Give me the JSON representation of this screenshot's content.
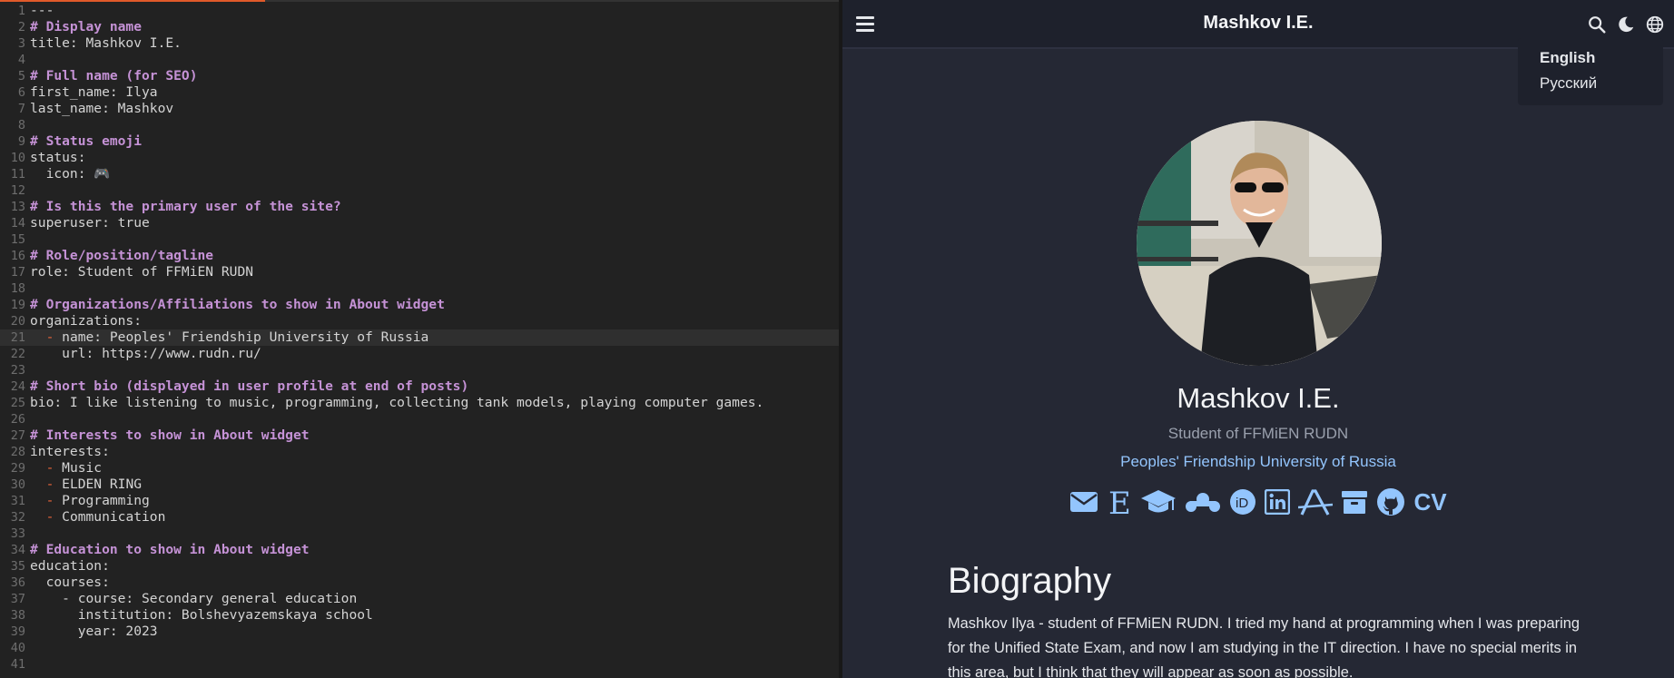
{
  "editor": {
    "lines": [
      {
        "n": "1",
        "text": "---",
        "kind": "plain"
      },
      {
        "n": "2",
        "text": "# Display name",
        "kind": "comment"
      },
      {
        "n": "3",
        "text": "title: Mashkov I.E.",
        "kind": "plain"
      },
      {
        "n": "4",
        "text": "",
        "kind": "plain"
      },
      {
        "n": "5",
        "text": "# Full name (for SEO)",
        "kind": "comment"
      },
      {
        "n": "6",
        "text": "first_name: Ilya",
        "kind": "plain"
      },
      {
        "n": "7",
        "text": "last_name: Mashkov",
        "kind": "plain"
      },
      {
        "n": "8",
        "text": "",
        "kind": "plain"
      },
      {
        "n": "9",
        "text": "# Status emoji",
        "kind": "comment"
      },
      {
        "n": "10",
        "text": "status:",
        "kind": "plain"
      },
      {
        "n": "11",
        "text": "  icon: 🎮",
        "kind": "plain"
      },
      {
        "n": "12",
        "text": "",
        "kind": "plain"
      },
      {
        "n": "13",
        "text": "# Is this the primary user of the site?",
        "kind": "comment"
      },
      {
        "n": "14",
        "text": "superuser: true",
        "kind": "plain"
      },
      {
        "n": "15",
        "text": "",
        "kind": "plain"
      },
      {
        "n": "16",
        "text": "# Role/position/tagline",
        "kind": "comment"
      },
      {
        "n": "17",
        "text": "role: Student of FFMiEN RUDN",
        "kind": "plain"
      },
      {
        "n": "18",
        "text": "",
        "kind": "plain"
      },
      {
        "n": "19",
        "text": "# Organizations/Affiliations to show in About widget",
        "kind": "comment"
      },
      {
        "n": "20",
        "text": "organizations:",
        "kind": "plain"
      },
      {
        "n": "21",
        "text": "name: Peoples' Friendship University of Russia",
        "kind": "list",
        "indent": "  ",
        "current": true
      },
      {
        "n": "22",
        "text": "    url: https://www.rudn.ru/",
        "kind": "plain"
      },
      {
        "n": "23",
        "text": "",
        "kind": "plain"
      },
      {
        "n": "24",
        "text": "# Short bio (displayed in user profile at end of posts)",
        "kind": "comment"
      },
      {
        "n": "25",
        "text": "bio: I like listening to music, programming, collecting tank models, playing computer games.",
        "kind": "plain"
      },
      {
        "n": "26",
        "text": "",
        "kind": "plain"
      },
      {
        "n": "27",
        "text": "# Interests to show in About widget",
        "kind": "comment"
      },
      {
        "n": "28",
        "text": "interests:",
        "kind": "plain"
      },
      {
        "n": "29",
        "text": "Music",
        "kind": "list",
        "indent": "  "
      },
      {
        "n": "30",
        "text": "ELDEN RING",
        "kind": "list",
        "indent": "  "
      },
      {
        "n": "31",
        "text": "Programming",
        "kind": "list",
        "indent": "  "
      },
      {
        "n": "32",
        "text": "Communication",
        "kind": "list",
        "indent": "  "
      },
      {
        "n": "33",
        "text": "",
        "kind": "plain"
      },
      {
        "n": "34",
        "text": "# Education to show in About widget",
        "kind": "comment"
      },
      {
        "n": "35",
        "text": "education:",
        "kind": "plain"
      },
      {
        "n": "36",
        "text": "  courses:",
        "kind": "plain"
      },
      {
        "n": "37",
        "text": "    - course: Secondary general education",
        "kind": "plain"
      },
      {
        "n": "38",
        "text": "      institution: Bolshevyazemskaya school",
        "kind": "plain"
      },
      {
        "n": "39",
        "text": "      year: 2023",
        "kind": "plain"
      },
      {
        "n": "40",
        "text": "",
        "kind": "plain"
      },
      {
        "n": "41",
        "text": "",
        "kind": "plain"
      }
    ]
  },
  "preview": {
    "navbar": {
      "title": "Mashkov I.E.",
      "icons": [
        "menu-icon",
        "search-icon",
        "moon-icon",
        "globe-icon"
      ]
    },
    "language_menu": {
      "items": [
        "English",
        "Русский"
      ],
      "active": "English"
    },
    "profile": {
      "name": "Mashkov I.E.",
      "role": "Student of FFMiEN RUDN",
      "organization": "Peoples' Friendship University of Russia",
      "socials": [
        "envelope-icon",
        "elibrary-icon",
        "graduation-cap-icon",
        "mendeley-icon",
        "orcid-icon",
        "linkedin-icon",
        "arxiv-icon",
        "archive-icon",
        "github-icon"
      ],
      "cv_label": "CV"
    },
    "biography": {
      "heading": "Biography",
      "text": "Mashkov Ilya - student of FFMiEN RUDN. I tried my hand at programming when I was preparing for the Unified State Exam, and now I am studying in the IT direction. I have no special merits in this area, but I think that they will appear as soon as possible."
    },
    "colors": {
      "accent": "#93c5fd",
      "background": "#252834",
      "navbar": "#1e212c"
    }
  }
}
